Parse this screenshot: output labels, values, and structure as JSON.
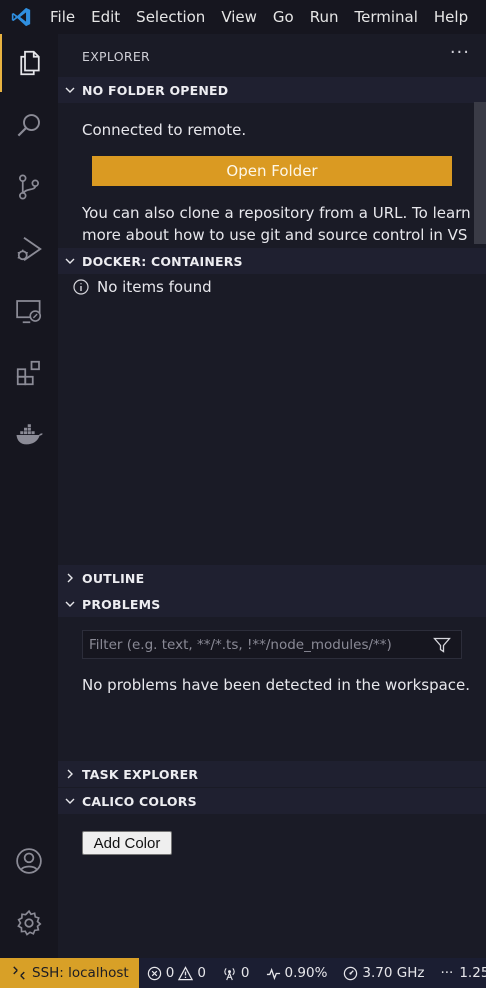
{
  "menu": [
    "File",
    "Edit",
    "Selection",
    "View",
    "Go",
    "Run",
    "Terminal",
    "Help"
  ],
  "sidebar": {
    "title": "EXPLORER",
    "more": "···"
  },
  "no_folder": {
    "title": "NO FOLDER OPENED",
    "connected": "Connected to remote.",
    "open_folder": "Open Folder",
    "clone_line1": "You can also clone a repository from a URL. To learn",
    "clone_line2": "more about how to use git and source control in VS"
  },
  "docker": {
    "title": "DOCKER: CONTAINERS",
    "empty": "No items found"
  },
  "outline": {
    "title": "OUTLINE"
  },
  "problems": {
    "title": "PROBLEMS",
    "filter_placeholder": "Filter (e.g. text, **/*.ts, !**/node_modules/**)",
    "message": "No problems have been detected in the workspace."
  },
  "task_explorer": {
    "title": "TASK EXPLORER"
  },
  "calico": {
    "title": "CALICO COLORS",
    "add_color": "Add Color"
  },
  "status": {
    "remote": "SSH: localhost",
    "errors": "0",
    "warnings": "0",
    "ports": "0",
    "cpu": "0.90%",
    "freq": "3.70 GHz",
    "more": "···",
    "load": "1.25"
  },
  "colors": {
    "accent": "#da9a22",
    "background": "#1a1b26",
    "activity_bar": "#16161f",
    "status_bar": "#1b1e32"
  }
}
